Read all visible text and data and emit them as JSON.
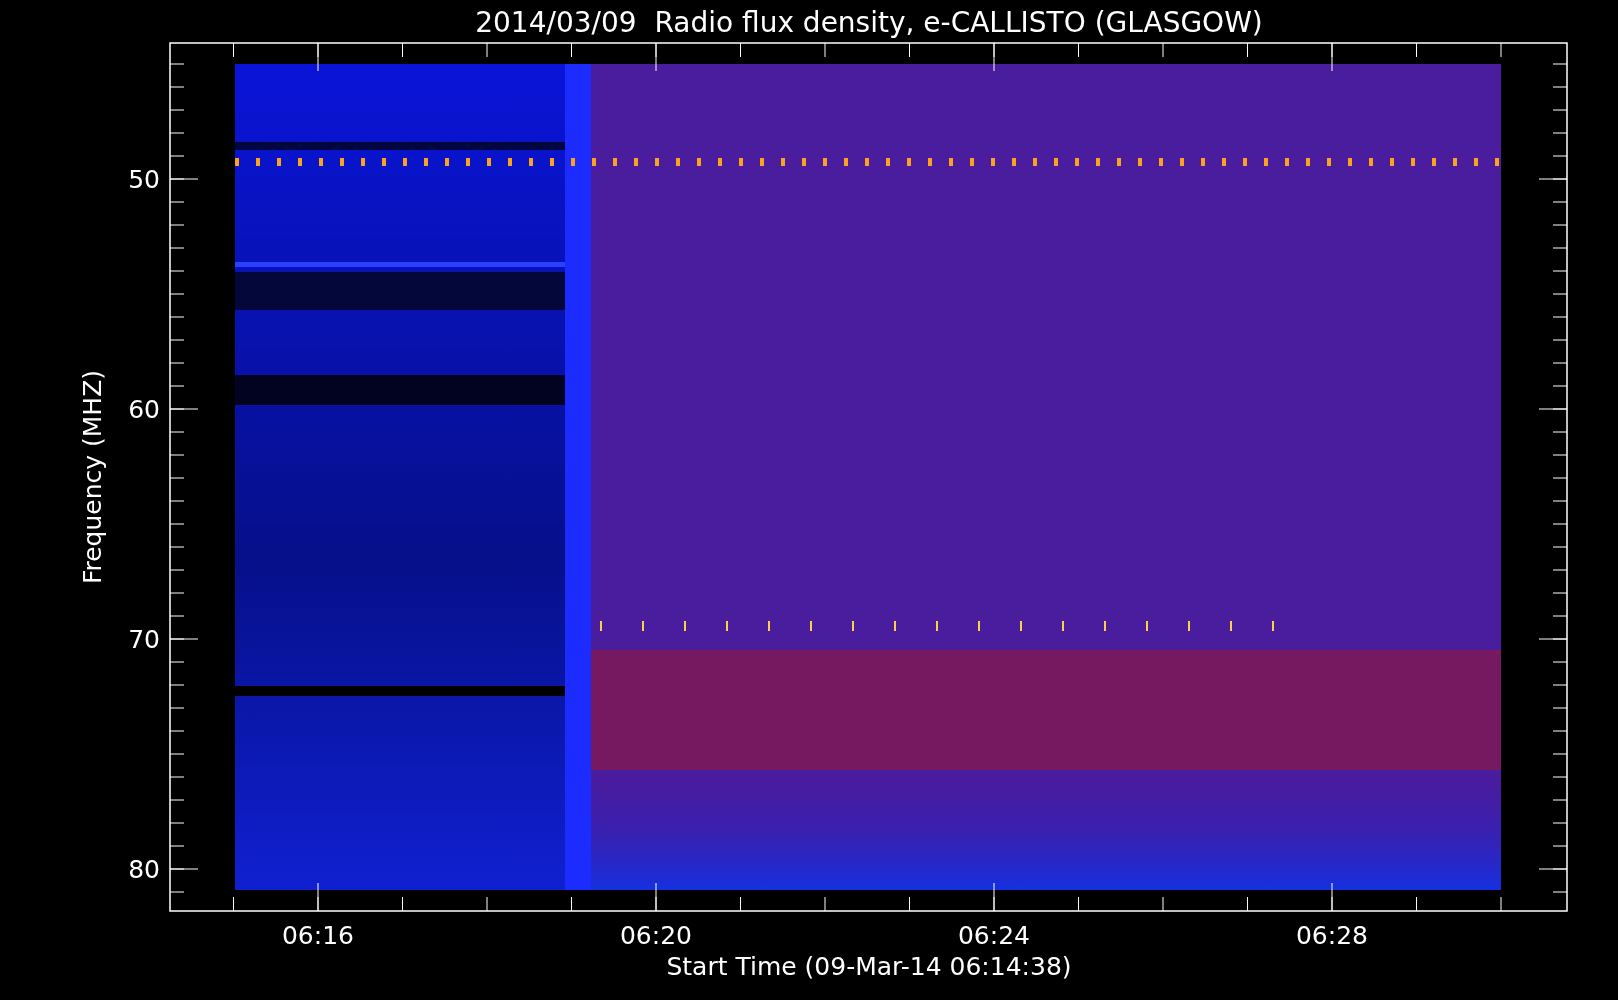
{
  "title": "2014/03/09  Radio flux density, e-CALLISTO (GLASGOW)",
  "y_axis": {
    "label": "Frequency (MHZ)",
    "ticks": [
      "50",
      "60",
      "70",
      "80"
    ]
  },
  "x_axis": {
    "label": "Start Time (09-Mar-14 06:14:38)",
    "ticks": [
      "06:16",
      "06:20",
      "06:24",
      "06:28"
    ]
  }
}
